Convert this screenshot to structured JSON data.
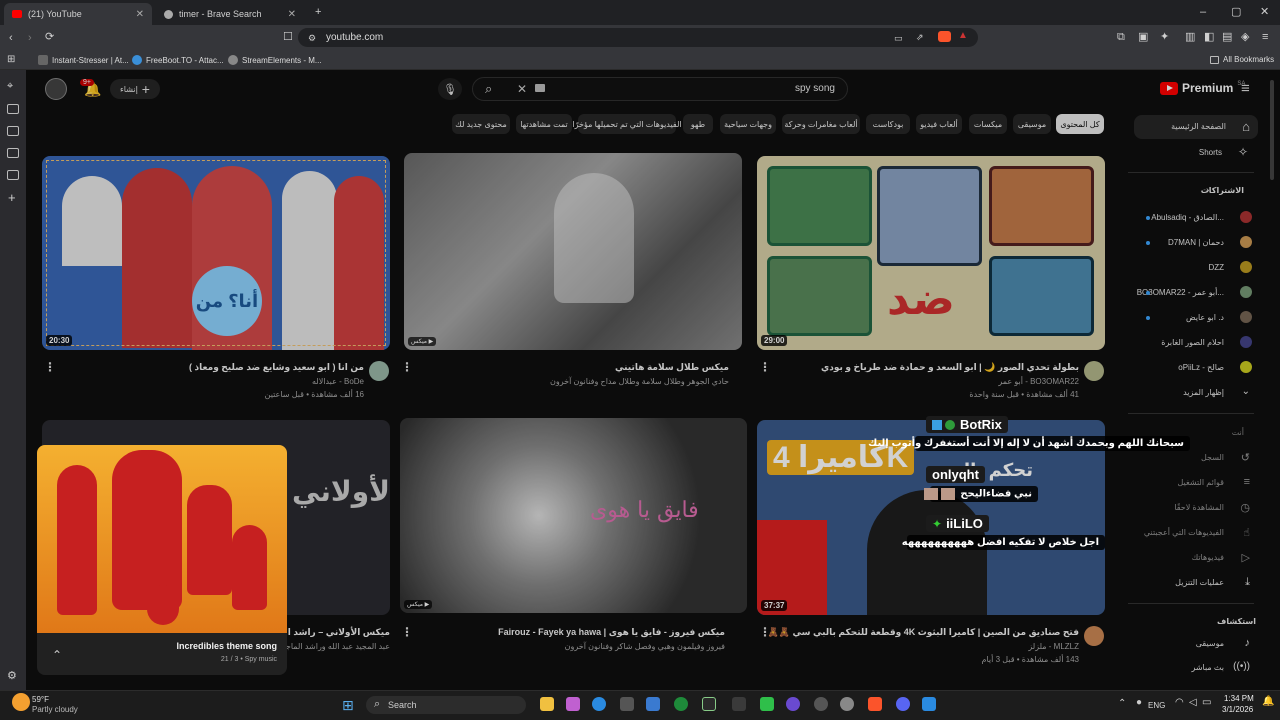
{
  "browser": {
    "tabs": [
      {
        "title": "(21) YouTube",
        "active": true
      },
      {
        "title": "timer - Brave Search",
        "active": false
      }
    ],
    "url": "youtube.com",
    "bookmarks": [
      "Instant-Stresser | At...",
      "FreeBoot.TO - Attac...",
      "StreamElements - M..."
    ],
    "all_bookmarks": "All Bookmarks"
  },
  "header": {
    "logo": "Premium",
    "logo_sup": "SA",
    "search_value": "spy song",
    "create_label": "إنشاء",
    "notif_count": "9+"
  },
  "chips": [
    {
      "label": "كل المحتوى",
      "selected": true
    },
    {
      "label": "موسيقى"
    },
    {
      "label": "ميكسات"
    },
    {
      "label": "ألعاب فيديو"
    },
    {
      "label": "بودكاست"
    },
    {
      "label": "ألعاب مغامرات وحركة"
    },
    {
      "label": "وجهات سياحية"
    },
    {
      "label": "طهو"
    },
    {
      "label": "الفيديوهات التي تم تحميلها مؤخرًا"
    },
    {
      "label": "تمت مشاهدتها"
    },
    {
      "label": "محتوى جديد لك"
    }
  ],
  "videos": [
    {
      "title": "بطولة تحدي الصور 🌙 | ابو السعد و حمادة ضد طرباخ و بودي",
      "channel": "BO3OMAR22 - أبو عمر",
      "meta": "41 ألف مشاهدة • قبل سنة واحدة",
      "duration": "29:00",
      "thumb_text": "ضد"
    },
    {
      "title": "ميكس طلال سلامة هاتيني",
      "channel": "حادي الجوهر وطلال سلامة وطلال مداح وفنانون آخرون",
      "meta": "",
      "duration": "",
      "badge": "ميكس"
    },
    {
      "title": "من انا ( ابو سعيد وشايع ضد صليح ومعاذ )",
      "channel": "BoDe - عبدالاله",
      "meta": "16 ألف مشاهدة • قبل ساعتين",
      "duration": "20:30",
      "thumb_text": "أنا؟ من"
    },
    {
      "title": "فتح صناديق من الصين | كاميرا البثوث 4K وقطعة للتحكم بالبي سي 🧸🧸",
      "channel": "MLZLZ - ملزلز",
      "meta": "143 ألف مشاهدة • قبل 3 أيام",
      "duration": "37:37",
      "thumb_text": "كاميرا 4K",
      "thumb_text2": "تحكم بالبث"
    },
    {
      "title": "ميكس فيروز - فايق يا هوى | Fairouz - Fayek ya hawa",
      "channel": "فيروز وفيلمون وهبي وفصل شاكر وفنانون آخرون",
      "meta": "",
      "duration": "",
      "badge": "ميكس",
      "thumb_text": "فايق يا هوى"
    },
    {
      "title": "ميكس الأولاني – راشد الماجد و...",
      "channel": "عبد المجيد عبد الله وراشد الماجد وفنانون آخرون",
      "meta": "",
      "duration": "",
      "thumb_text": "الأولاني"
    }
  ],
  "right_nav": {
    "home": "الصفحة الرئيسية",
    "shorts": "Shorts",
    "subscriptions": "الاشتراكات",
    "subs": [
      "Abulsadiq - الصادق...",
      "D7MAN | دحمان",
      "DZZ",
      "BO3OMAR22 - أبو عمر...",
      "د. ابو عايض",
      "احلام الصور الغابرة",
      "oPiiLz - صالح"
    ],
    "show_more": "إظهار المزيد",
    "you": "أنت",
    "you_items": [
      "السجل",
      "قوائم التشغيل",
      "المشاهدة لاحقًا",
      "الفيديوهات التي أعجبتني",
      "فيديوهاتك",
      "عمليات التنزيل"
    ],
    "explore": "استكشاف",
    "explore_items": [
      "موسيقى",
      "بث مباشر"
    ]
  },
  "overlay": {
    "users": [
      {
        "name": "BotRix",
        "msg": "سبحانك اللهم وبحمدك أشهد أن لا إله إلا أنت أستغفرك وأتوب إليك"
      },
      {
        "name": "onlyqht",
        "msg": "نبي فضاءاليحح"
      },
      {
        "name": "iiLiLO",
        "msg": "اجل خلاص لا تفكيه افضل ههههههههههه"
      }
    ]
  },
  "miniplayer": {
    "title": "Incredibles theme song",
    "meta": "21 / 3 • Spy music"
  },
  "taskbar": {
    "weather_temp": "59°F",
    "weather_desc": "Partly cloudy",
    "search": "Search",
    "lang": "ENG",
    "time": "1:34 PM",
    "date": "3/1/2026"
  }
}
